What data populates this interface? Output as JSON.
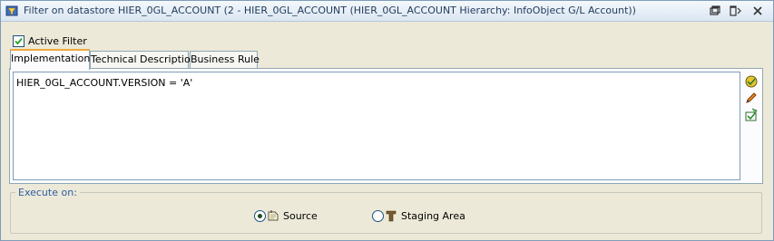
{
  "window": {
    "title": "Filter on datastore HIER_0GL_ACCOUNT (2 - HIER_0GL_ACCOUNT (HIER_0GL_ACCOUNT Hierarchy: InfoObject G/L Account))",
    "title_icon": "filter-icon",
    "controls": [
      "restore-icon",
      "pin-icon",
      "close-icon"
    ]
  },
  "active_filter": {
    "label": "Active Filter",
    "checked": true
  },
  "tabs": [
    {
      "label": "Implementation",
      "active": true
    },
    {
      "label": "Technical Description",
      "active": false
    },
    {
      "label": "Business Rule",
      "active": false
    }
  ],
  "editor": {
    "text": "HIER_0GL_ACCOUNT.VERSION = 'A'"
  },
  "editor_tools": [
    "expression-editor-icon",
    "edit-pencil-icon",
    "check-expression-icon"
  ],
  "execute_on": {
    "legend": "Execute on:",
    "options": [
      {
        "label": "Source",
        "selected": true,
        "icon": "source-icon"
      },
      {
        "label": "Staging Area",
        "selected": false,
        "icon": "staging-area-icon"
      }
    ]
  },
  "colors": {
    "title_text": "#1f3a5c",
    "legend_text": "#2f5ea3",
    "tab_accent": "#f0a83c",
    "background": "#ece9d8"
  }
}
